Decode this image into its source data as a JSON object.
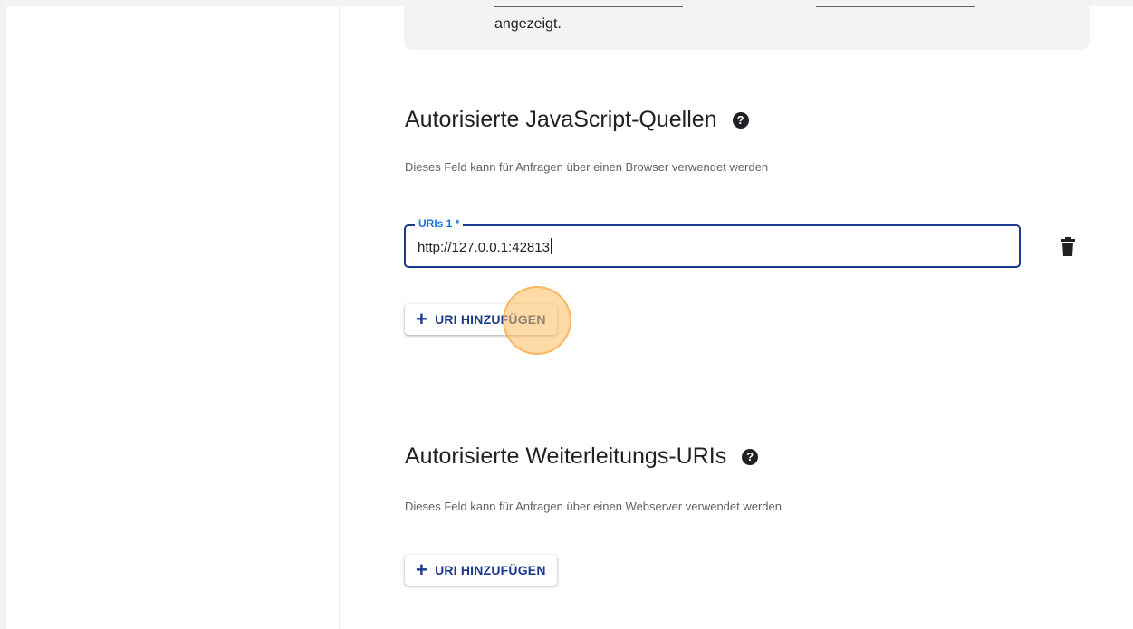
{
  "info_box": {
    "text": "angezeigt."
  },
  "js_origins": {
    "title": "Autorisierte JavaScript-Quellen",
    "help_icon": "?",
    "description": "Dieses Feld kann für Anfragen über einen Browser verwendet werden",
    "uri_field": {
      "label": "URIs 1 *",
      "value": "http://127.0.0.1:42813"
    },
    "delete_icon": "trash-icon",
    "add_button": {
      "icon": "+",
      "label": "URI HINZUFÜGEN"
    }
  },
  "redirect_uris": {
    "title": "Autorisierte Weiterleitungs-URIs",
    "help_icon": "?",
    "description": "Dieses Feld kann für Anfragen über einen Webserver verwendet werden",
    "add_button": {
      "icon": "+",
      "label": "URI HINZUFÜGEN"
    }
  },
  "colors": {
    "accent": "#1a3a8f",
    "label_blue": "#1a73e8",
    "click_highlight": "#fbbc5c"
  }
}
